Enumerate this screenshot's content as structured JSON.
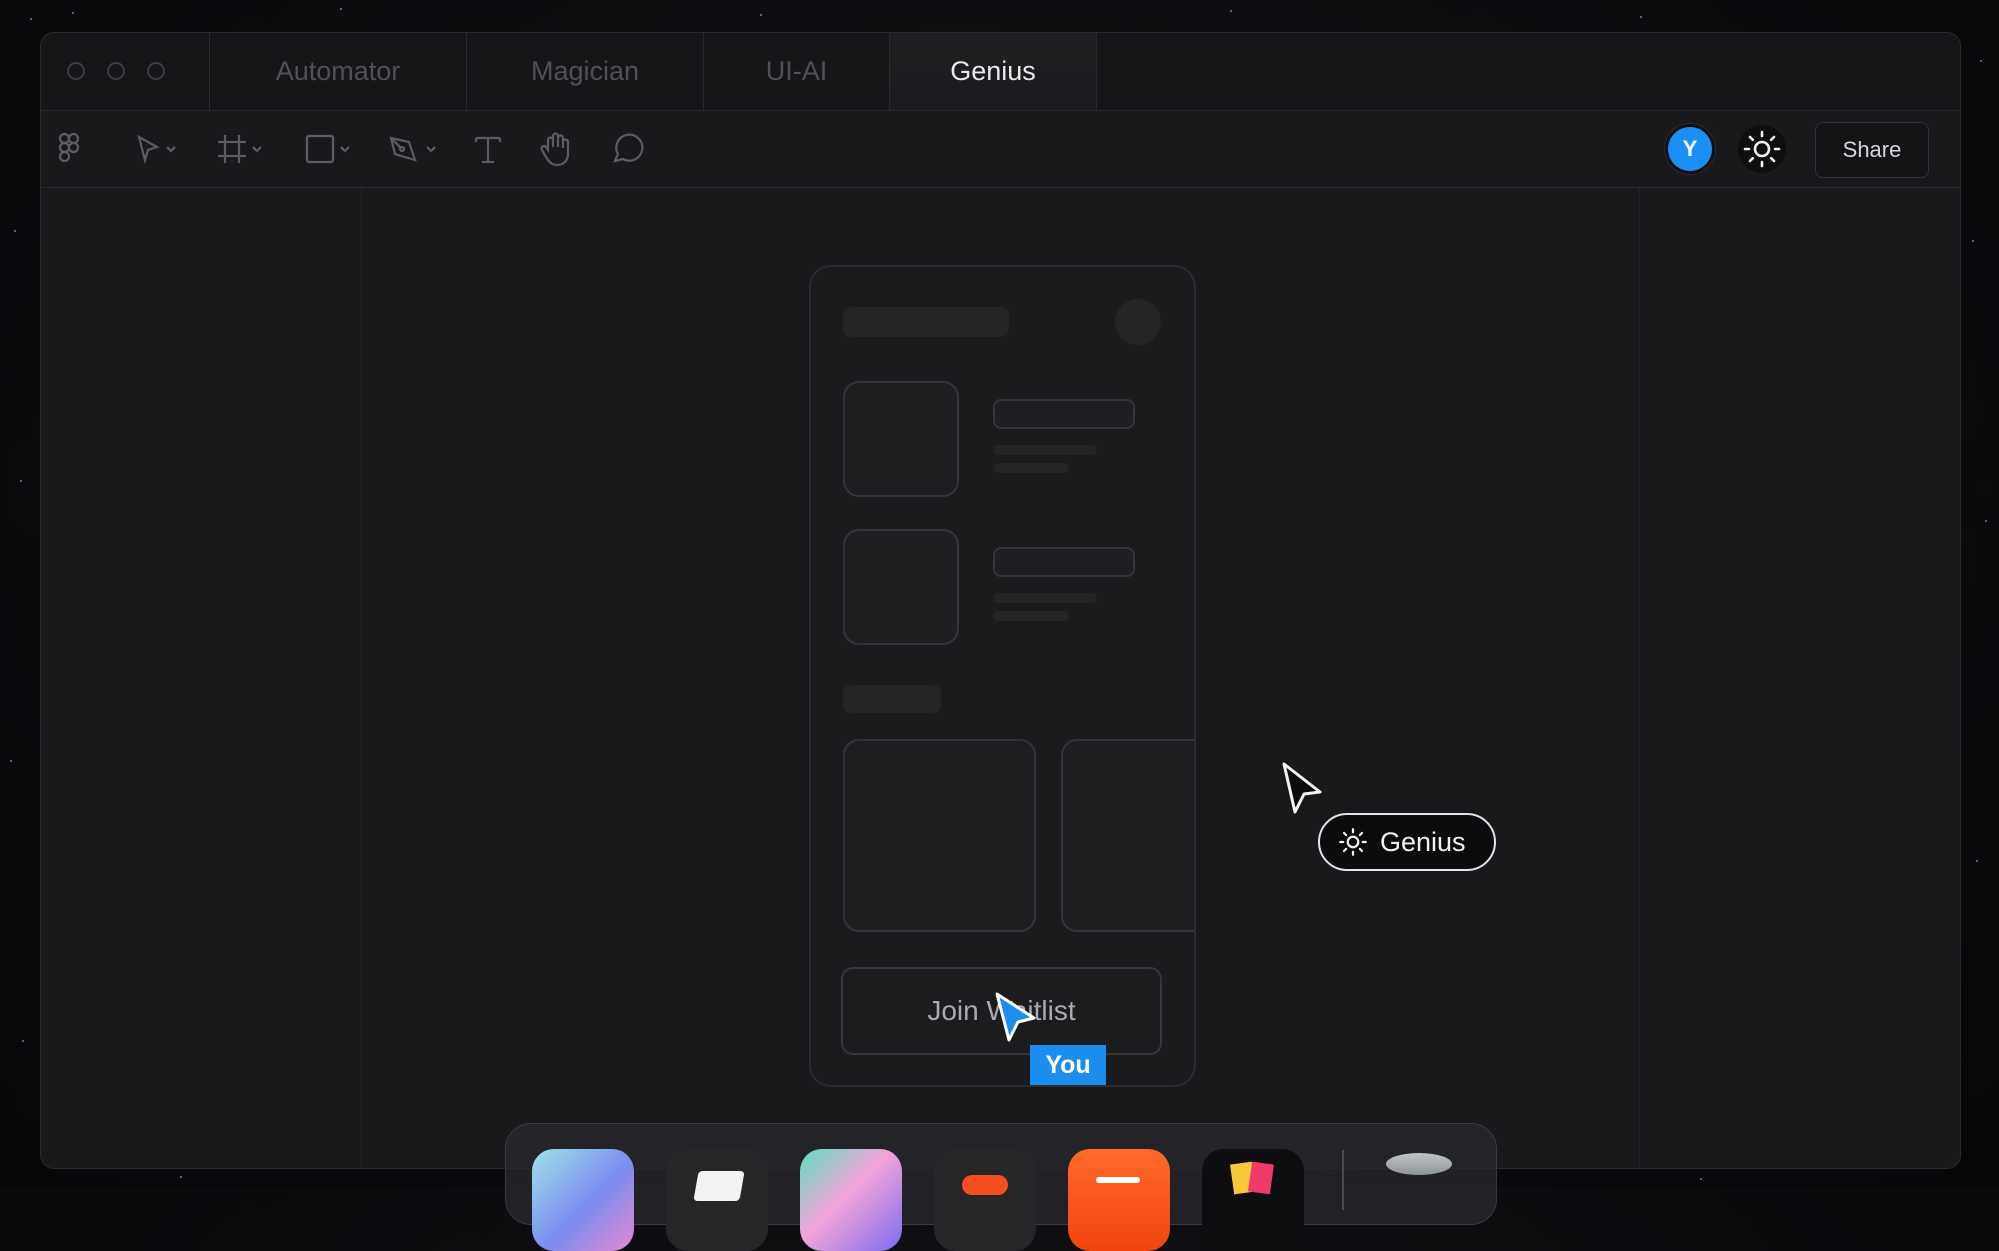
{
  "tabs": [
    {
      "label": "Automator"
    },
    {
      "label": "Magician"
    },
    {
      "label": "UI-AI"
    },
    {
      "label": "Genius",
      "active": true
    }
  ],
  "toolbar": {
    "icons": [
      "figma-logo-icon",
      "move-tool-icon",
      "frame-tool-icon",
      "rectangle-tool-icon",
      "pen-tool-icon",
      "text-tool-icon",
      "hand-tool-icon",
      "comment-tool-icon"
    ],
    "avatar_initial": "Y",
    "avatar_color": "#1a8ff5",
    "share_label": "Share"
  },
  "canvas": {
    "phone": {
      "button_label": "Join Waitlist"
    },
    "you_cursor": {
      "label": "You",
      "color": "#1c8ef0"
    },
    "genius_cursor": {
      "label": "Genius"
    }
  },
  "dock": {
    "apps": [
      "arc-browser-icon",
      "notion-app-icon",
      "design-app-icon",
      "figma-app-icon",
      "orange-app-icon",
      "color-app-icon",
      "trash-icon"
    ]
  }
}
